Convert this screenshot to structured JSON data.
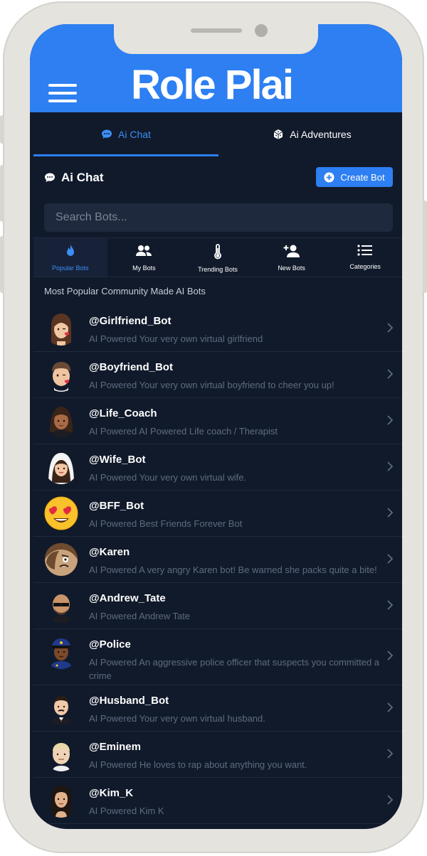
{
  "app": {
    "logo": "Role Plai",
    "menu_icon": "hamburger-menu-icon"
  },
  "tabs": [
    {
      "label": "Ai Chat",
      "icon": "chat-bubble-icon",
      "active": true
    },
    {
      "label": "Ai Adventures",
      "icon": "dice-icon",
      "active": false
    }
  ],
  "section": {
    "title": "Ai Chat",
    "create_label": "Create Bot"
  },
  "search": {
    "placeholder": "Search Bots..."
  },
  "filters": [
    {
      "label": "Popular Bots",
      "icon": "flame-icon",
      "active": true
    },
    {
      "label": "My Bots",
      "icon": "users-icon",
      "active": false
    },
    {
      "label": "Trending Bots",
      "icon": "thermometer-icon",
      "active": false
    },
    {
      "label": "New Bots",
      "icon": "user-plus-icon",
      "active": false
    },
    {
      "label": "Categories",
      "icon": "list-icon",
      "active": false
    }
  ],
  "list_heading": "Most Popular Community Made AI Bots",
  "bots": [
    {
      "name": "@Girlfriend_Bot",
      "desc": "AI Powered Your very own virtual girlfriend"
    },
    {
      "name": "@Boyfriend_Bot",
      "desc": "AI Powered Your very own virtual boyfriend to cheer you up!"
    },
    {
      "name": "@Life_Coach",
      "desc": "AI Powered AI Powered Life coach / Therapist"
    },
    {
      "name": "@Wife_Bot",
      "desc": "AI Powered Your very own virtual wife."
    },
    {
      "name": "@BFF_Bot",
      "desc": "AI Powered Best Friends Forever Bot"
    },
    {
      "name": "@Karen",
      "desc": "AI Powered A very angry Karen bot! Be warned she packs quite a bite!"
    },
    {
      "name": "@Andrew_Tate",
      "desc": "AI Powered Andrew Tate"
    },
    {
      "name": "@Police",
      "desc": "AI Powered An aggressive police officer that suspects you committed a crime"
    },
    {
      "name": "@Husband_Bot",
      "desc": "AI Powered Your very own virtual husband."
    },
    {
      "name": "@Eminem",
      "desc": "AI Powered He loves to rap about anything you want."
    },
    {
      "name": "@Kim_K",
      "desc": "AI Powered Kim K"
    }
  ],
  "colors": {
    "accent": "#2d7ff2",
    "background": "#111a2b",
    "muted_text": "#5f6b80"
  }
}
